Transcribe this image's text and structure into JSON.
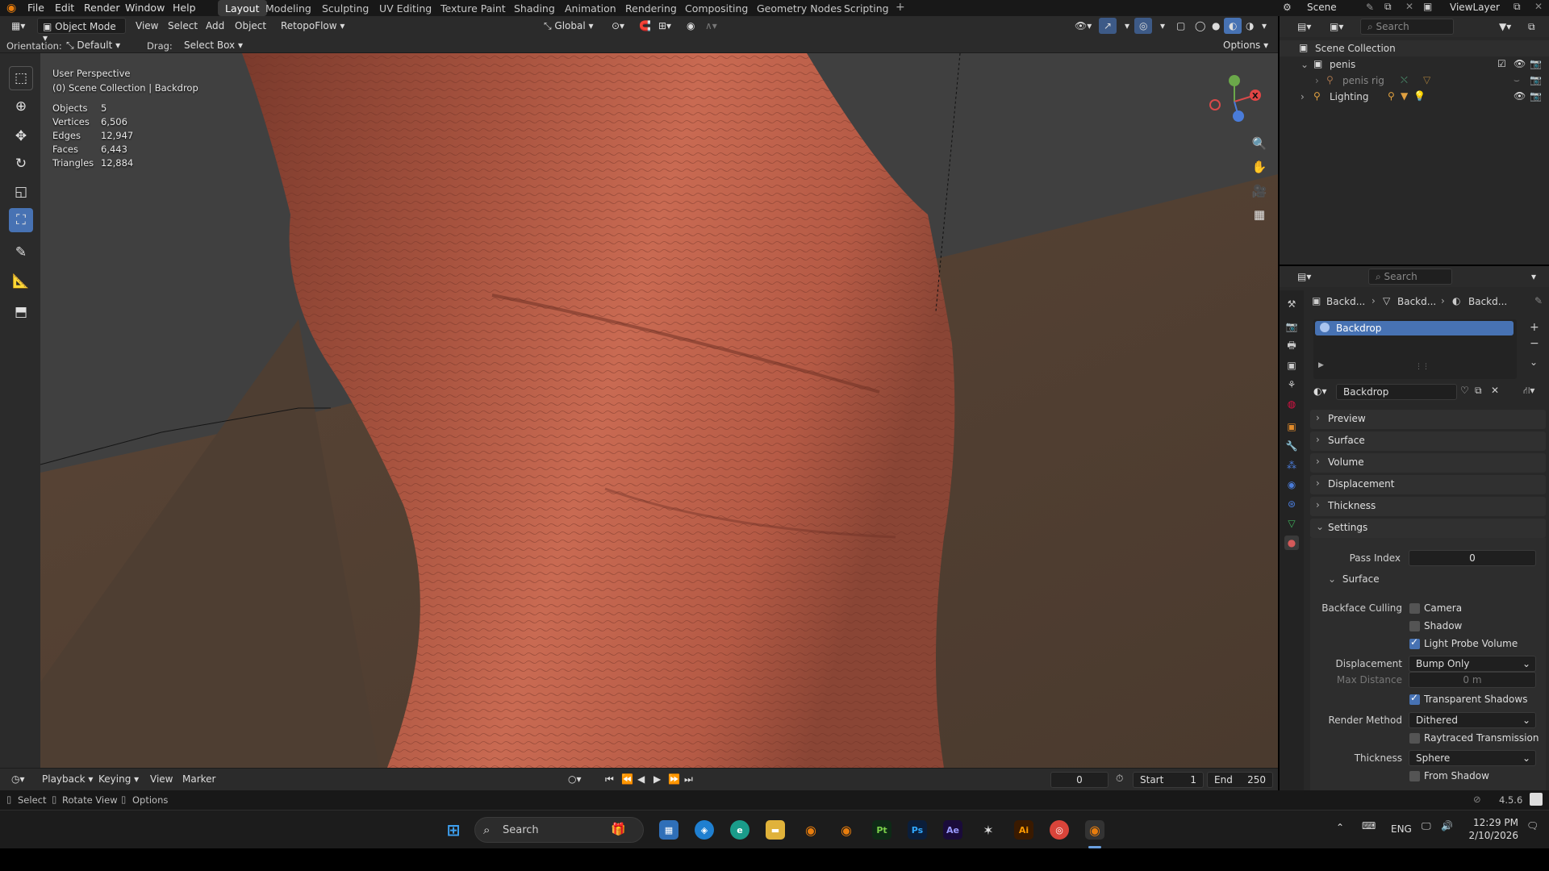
{
  "menubar": {
    "items": [
      "File",
      "Edit",
      "Render",
      "Window",
      "Help"
    ],
    "workspaces": [
      "Layout",
      "Modeling",
      "Sculpting",
      "UV Editing",
      "Texture Paint",
      "Shading",
      "Animation",
      "Rendering",
      "Compositing",
      "Geometry Nodes",
      "Scripting"
    ],
    "active_workspace": "Layout",
    "scene_name": "Scene",
    "view_layer": "ViewLayer"
  },
  "header": {
    "mode": "Object Mode",
    "menus": [
      "View",
      "Select",
      "Add",
      "Object"
    ],
    "addon": "RetopoFlow",
    "transform_orientation": "Global",
    "orientation_label": "Orientation:",
    "orientation_value": "Default",
    "drag_label": "Drag:",
    "drag_value": "Select Box",
    "options": "Options"
  },
  "viewport": {
    "view_name": "User Perspective",
    "collection_path": "(0) Scene Collection | Backdrop",
    "stats": [
      {
        "label": "Objects",
        "value": "5"
      },
      {
        "label": "Vertices",
        "value": "6,506"
      },
      {
        "label": "Edges",
        "value": "12,947"
      },
      {
        "label": "Faces",
        "value": "6,443"
      },
      {
        "label": "Triangles",
        "value": "12,884"
      }
    ],
    "gizmo_x": "X"
  },
  "timeline": {
    "menus": [
      "Playback",
      "Keying",
      "View",
      "Marker"
    ],
    "current_frame": "0",
    "start_label": "Start",
    "start": "1",
    "end_label": "End",
    "end": "250"
  },
  "statusbar": {
    "select": "Select",
    "rotate": "Rotate View",
    "options": "Options",
    "version": "4.5.6"
  },
  "outliner": {
    "search_placeholder": "Search",
    "root": "Scene Collection",
    "items": [
      {
        "name": "penis"
      },
      {
        "name": "penis rig"
      },
      {
        "name": "Lighting"
      }
    ]
  },
  "properties": {
    "search_placeholder": "Search",
    "breadcrumb": [
      "Backd...",
      "Backd...",
      "Backd..."
    ],
    "material_slot": "Backdrop",
    "material_name": "Backdrop",
    "panels": [
      "Preview",
      "Surface",
      "Volume",
      "Displacement",
      "Thickness",
      "Settings"
    ],
    "pass_index_label": "Pass Index",
    "pass_index": "0",
    "surface_sub": "Surface",
    "backface_culling_label": "Backface Culling",
    "camera": "Camera",
    "shadow": "Shadow",
    "light_probe_volume": "Light Probe Volume",
    "displacement_label": "Displacement",
    "displacement_value": "Bump Only",
    "max_distance_label": "Max Distance",
    "max_distance": "0 m",
    "transparent_shadows": "Transparent Shadows",
    "render_method_label": "Render Method",
    "render_method": "Dithered",
    "raytraced_transmission": "Raytraced Transmission",
    "thickness_label": "Thickness",
    "thickness_value": "Sphere",
    "from_shadow": "From Shadow",
    "checkbox_states": {
      "camera": false,
      "shadow": false,
      "light_probe_volume": true,
      "transparent_shadows": true,
      "raytraced_transmission": false,
      "from_shadow": false
    }
  },
  "taskbar": {
    "search": "Search",
    "lang": "ENG",
    "time": "12:29 PM",
    "date": "2/10/2026",
    "apps": [
      "Pt",
      "Ps",
      "Ae",
      "Ai"
    ]
  },
  "colors": {
    "accent": "#4772b3",
    "viewport_bg": "#3f3f3f",
    "skin": "#b5604a",
    "backdrop": "#5e4535"
  }
}
